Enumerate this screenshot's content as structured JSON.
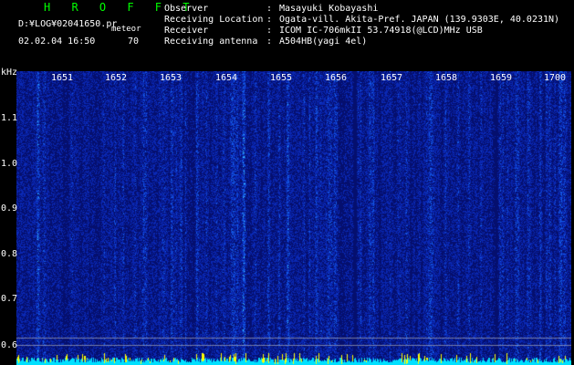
{
  "header": {
    "app_title": "H R O F F T",
    "file_path": "D:¥LOG¥02041650.pr",
    "mode": "meteor",
    "datetime": "02.02.04 16:50",
    "count": "70"
  },
  "info": [
    {
      "label": "Observer",
      "value": "Masayuki Kobayashi"
    },
    {
      "label": "Receiving Location",
      "value": "Ogata-vill. Akita-Pref. JAPAN (139.9303E, 40.0231N)"
    },
    {
      "label": "Receiver",
      "value": "ICOM IC-706mkII 53.74918(@LCD)MHz USB"
    },
    {
      "label": "Receiving antenna",
      "value": "A504HB(yagi 4el)"
    }
  ],
  "info_sep": ":",
  "axis": {
    "y_unit": "kHz",
    "y_ticks": [
      "1.1",
      "1.0",
      "0.9",
      "0.8",
      "0.7",
      "0.6"
    ],
    "x_ticks": [
      "1651",
      "1652",
      "1653",
      "1654",
      "1655",
      "1656",
      "1657",
      "1658",
      "1659",
      "1700"
    ]
  },
  "colors": {
    "background": "#000000",
    "title": "#00ff00",
    "spectro_base": "#0a1a8a",
    "baseline": "#00e0ff",
    "burst": "#ffff00",
    "ref_line": "#c0c0c0"
  }
}
